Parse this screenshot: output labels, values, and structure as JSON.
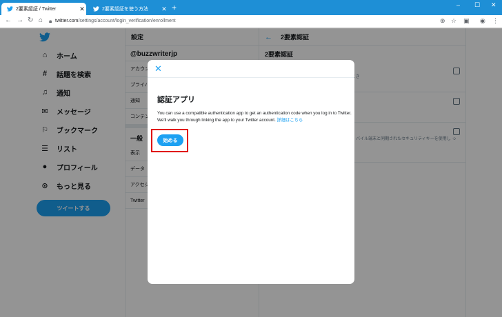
{
  "browser": {
    "tabs": [
      {
        "title": "2要素認証 / Twitter",
        "active": true
      },
      {
        "title": "2要素認証を使う方法",
        "active": false
      }
    ],
    "new_tab": "+",
    "url_host": "twitter.com",
    "url_path": "/settings/account/login_verification/enrollment",
    "window_controls": [
      "–",
      "☐",
      "✕"
    ]
  },
  "nav": {
    "items": [
      {
        "icon": "home-icon",
        "label": "ホーム"
      },
      {
        "icon": "hashtag-icon",
        "label": "話題を検索"
      },
      {
        "icon": "bell-icon",
        "label": "通知"
      },
      {
        "icon": "envelope-icon",
        "label": "メッセージ"
      },
      {
        "icon": "bookmark-icon",
        "label": "ブックマーク"
      },
      {
        "icon": "list-icon",
        "label": "リスト"
      },
      {
        "icon": "avatar-icon",
        "label": "プロフィール"
      },
      {
        "icon": "more-icon",
        "label": "もっと見る"
      }
    ],
    "tweet_button": "ツイートする"
  },
  "settings": {
    "header": "設定",
    "handle": "@buzzwriterjp",
    "items": [
      "アカウン",
      "プライバ",
      "通知",
      "コンテン"
    ],
    "general_header": "一般",
    "general_items": [
      "表示",
      "データ",
      "アクセシ",
      "Twitter"
    ]
  },
  "detail": {
    "header": "2要素認証",
    "sub": "2要素認証",
    "options": [
      {
        "desc": "ョートメールを受信し、Twitterにログインするとき"
      },
      {
        "desc": "取り、Twitterにログインするたびに入力します。"
      },
      {
        "desc": "itter.comにログインするときに、物理的なセキュ バイル端末と同期されたセキュリティキーを使用し ってTwitterアプリにログインすることはできませ"
      }
    ]
  },
  "modal": {
    "close": "✕",
    "title": "認証アプリ",
    "body": "You can use a compatible authentication app to get an authentication code when you log in to Twitter. We'll walk you through linking the app to your Twitter account.",
    "learn_more": "詳細はこちら",
    "start_button": "始める"
  },
  "colors": {
    "accent": "#1da1f2",
    "chrome": "#1e8fd6",
    "highlight": "#e00000"
  }
}
